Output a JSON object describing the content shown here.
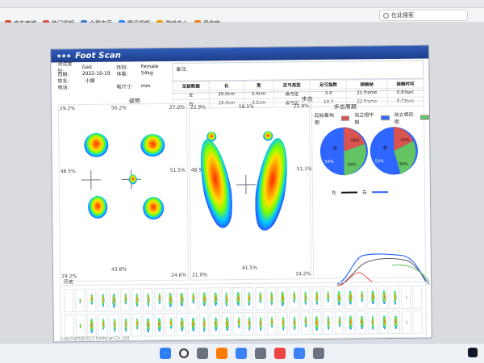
{
  "browser": {
    "bookmarks": [
      "京东商城",
      "热门视频",
      "企鹅电竞",
      "腾讯视频",
      "游戏中心",
      "爱淘宝"
    ],
    "search_placeholder": "在此搜索"
  },
  "app": {
    "logo_text": "Foot Scan",
    "patient": {
      "test_mode_label": "测试类型:",
      "test_mode_value": "Gait",
      "date_label": "日期:",
      "date_value": "2022-10-19",
      "name_label": "姓名:",
      "name_value": "小嫂",
      "phone_label": "电话:",
      "shoe_size_label": "鞋尺寸:",
      "shoe_size_unit": "mm",
      "gender_label": "性别:",
      "gender_value": "Female",
      "weight_label": "体重:",
      "weight_value": "54kg"
    },
    "notes": {
      "label": "备注:"
    },
    "metrics_table": {
      "headers": [
        "足部数据",
        "长",
        "宽",
        "足弓类型",
        "足弓指数",
        "接触帧",
        "接触时间"
      ],
      "rows": [
        [
          "左",
          "20.0cm",
          "5.6cm",
          "高弓足",
          "3.4",
          "25 frame",
          "0.83sec"
        ],
        [
          "右",
          "16.0cm",
          "3.5cm",
          "高弓足",
          "13.7",
          "22 frame",
          "0.73sec"
        ]
      ]
    },
    "sections": {
      "left_title": "姿势",
      "right_title": "步态",
      "gait_period": "步态周期",
      "legend": [
        "起始着地期",
        "站立相中期",
        "站立相后期"
      ],
      "left_right": {
        "left": "左",
        "right": "右"
      }
    },
    "left_panel": {
      "top_pct": "56.2%",
      "left_pct": "48.5%",
      "right_pct": "51.5%",
      "bottom_pct": "43.8%",
      "corner_tl": "29.2%",
      "corner_tr": "27.0%",
      "corner_bl": "19.2%",
      "corner_br": "24.6%"
    },
    "middle_panel": {
      "top_pct": "58.5%",
      "left_pct": "48.9%",
      "right_pct": "51.1%",
      "bottom_pct": "41.5%",
      "corner_tl": "22.9%",
      "corner_tr": "22.9%",
      "corner_bl": "21.0%",
      "corner_br": "19.2%"
    },
    "pies": {
      "left": {
        "label": "左",
        "values": [
          0.12,
          0.34,
          0.54
        ],
        "colors": [
          "#d9534f",
          "#2f66ff",
          "#62c462"
        ],
        "texts": [
          "10%",
          "54%",
          "35%"
        ]
      },
      "right": {
        "label": "右",
        "values": [
          0.14,
          0.4,
          0.46
        ],
        "colors": [
          "#d9534f",
          "#2f66ff",
          "#62c462"
        ],
        "texts": [
          "13%",
          "53%",
          "34%"
        ]
      }
    },
    "history": {
      "title": "历史"
    },
    "footer": "Copyright@2012 Footscan Co.,Ltd"
  },
  "taskbar": {
    "icons": [
      "windows-icon",
      "search-icon",
      "task-view-icon",
      "files-icon",
      "edge-icon",
      "store-icon",
      "app-icon",
      "app-icon-2",
      "app-icon-3"
    ]
  }
}
